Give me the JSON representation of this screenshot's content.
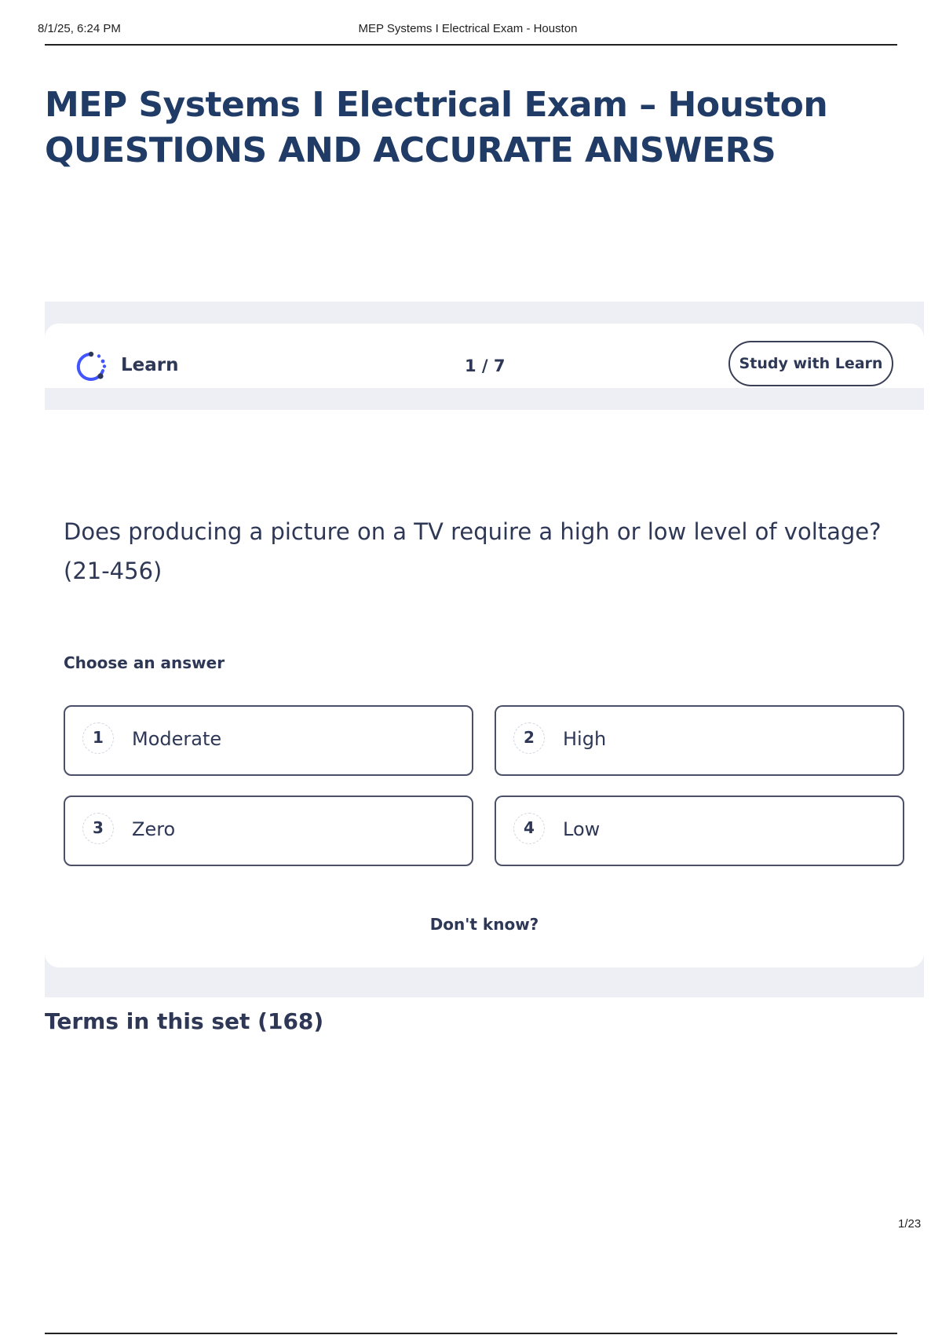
{
  "print_header": {
    "timestamp": "8/1/25, 6:24 PM",
    "title": "MEP Systems I Electrical Exam - Houston"
  },
  "document": {
    "title_line1": "MEP Systems I Electrical Exam – Houston",
    "title_line2": "QUESTIONS AND  ACCURATE ANSWERS"
  },
  "learn_card": {
    "logo_icon": "learn-progress-icon",
    "label": "Learn",
    "progress": "1 / 7",
    "study_button": "Study with Learn",
    "question": "Does producing a picture on a TV require a high or low level of voltage? (21-456)",
    "choose_label": "Choose an answer",
    "options": [
      {
        "number": "1",
        "label": "Moderate"
      },
      {
        "number": "2",
        "label": "High"
      },
      {
        "number": "3",
        "label": "Zero"
      },
      {
        "number": "4",
        "label": "Low"
      }
    ],
    "dont_know": "Don't know?"
  },
  "terms_heading": "Terms in this set (168)",
  "page_number": "1/23",
  "colors": {
    "title": "#1f3b66",
    "text": "#2e3856",
    "band": "#edeff4",
    "logo_accent": "#4255ff"
  }
}
